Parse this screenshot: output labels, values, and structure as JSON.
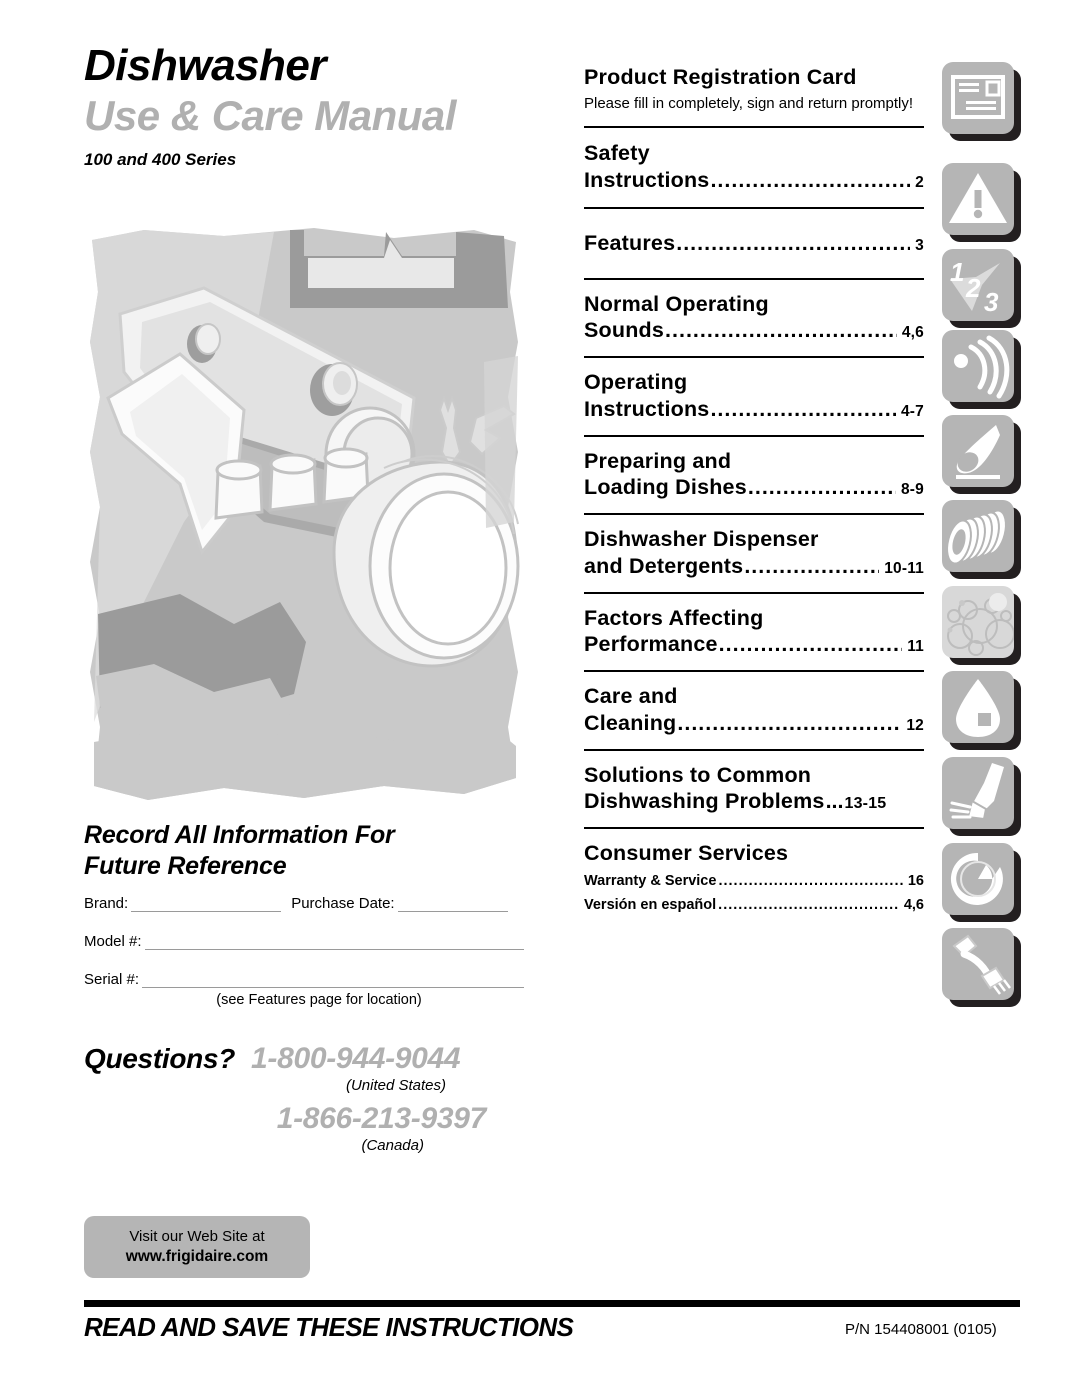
{
  "header": {
    "title": "Dishwasher",
    "subtitle": "Use & Care Manual",
    "series": "100 and 400 Series"
  },
  "toc": {
    "items": [
      {
        "title_line1": "Product Registration Card",
        "note": "Please fill in completely, sign and return promptly!",
        "icon": "registration-card-icon"
      },
      {
        "title_line1": "Safety",
        "title_line2": "Instructions",
        "page": "2",
        "icon": "warning-triangle-icon"
      },
      {
        "title_line1": "Features",
        "page": "3",
        "icon": "numbers-123-icon"
      },
      {
        "title_line1": "Normal Operating",
        "title_line2": "Sounds",
        "page": "4,6",
        "icon": "sound-waves-icon"
      },
      {
        "title_line1": "Operating",
        "title_line2": "Instructions",
        "page": "4-7",
        "icon": "finger-touch-icon"
      },
      {
        "title_line1": "Preparing and",
        "title_line2": "Loading Dishes",
        "page": "8-9",
        "icon": "stacked-plates-icon"
      },
      {
        "title_line1": "Dishwasher Dispenser",
        "title_line2": "and Detergents",
        "page": "10-11",
        "icon": "bubbles-icon"
      },
      {
        "title_line1": "Factors Affecting",
        "title_line2": "Performance",
        "page": "11",
        "icon": "water-drop-icon"
      },
      {
        "title_line1": "Care and",
        "title_line2": "Cleaning",
        "page": "12",
        "icon": "hand-cleaning-icon"
      },
      {
        "title_line1": "Solutions to Common",
        "title_line2": "Dishwashing Problems",
        "page": "13-15",
        "icon": "cycle-arrow-icon"
      },
      {
        "title_line1": "Consumer Services",
        "icon": "telephone-handset-icon",
        "subitems": [
          {
            "label": "Warranty & Service",
            "page": "16"
          },
          {
            "label": "Versión en español",
            "page": "4,6"
          }
        ]
      }
    ]
  },
  "record": {
    "heading_line1": "Record All Information For",
    "heading_line2": "Future Reference",
    "brand_label": "Brand:",
    "purchase_date_label": "Purchase Date:",
    "model_label": "Model #:",
    "serial_label": "Serial #:",
    "brand_value": "",
    "purchase_date_value": "",
    "model_value": "",
    "serial_value": "",
    "serial_note": "(see Features page for location)"
  },
  "questions": {
    "label": "Questions?",
    "phone_us": "1-800-944-9044",
    "caption_us": "(United States)",
    "phone_ca": "1-866-213-9397",
    "caption_ca": "(Canada)"
  },
  "website": {
    "line1": "Visit our Web Site at",
    "line2": "www.frigidaire.com"
  },
  "footer": {
    "instruction": "READ AND SAVE THESE INSTRUCTIONS",
    "part_number": "P/N 154408001 (0105)"
  },
  "colors": {
    "gray_title": "#b0b0b0",
    "gray_tile": "#b5b5b5",
    "shadow": "#231f20",
    "black": "#000000"
  }
}
